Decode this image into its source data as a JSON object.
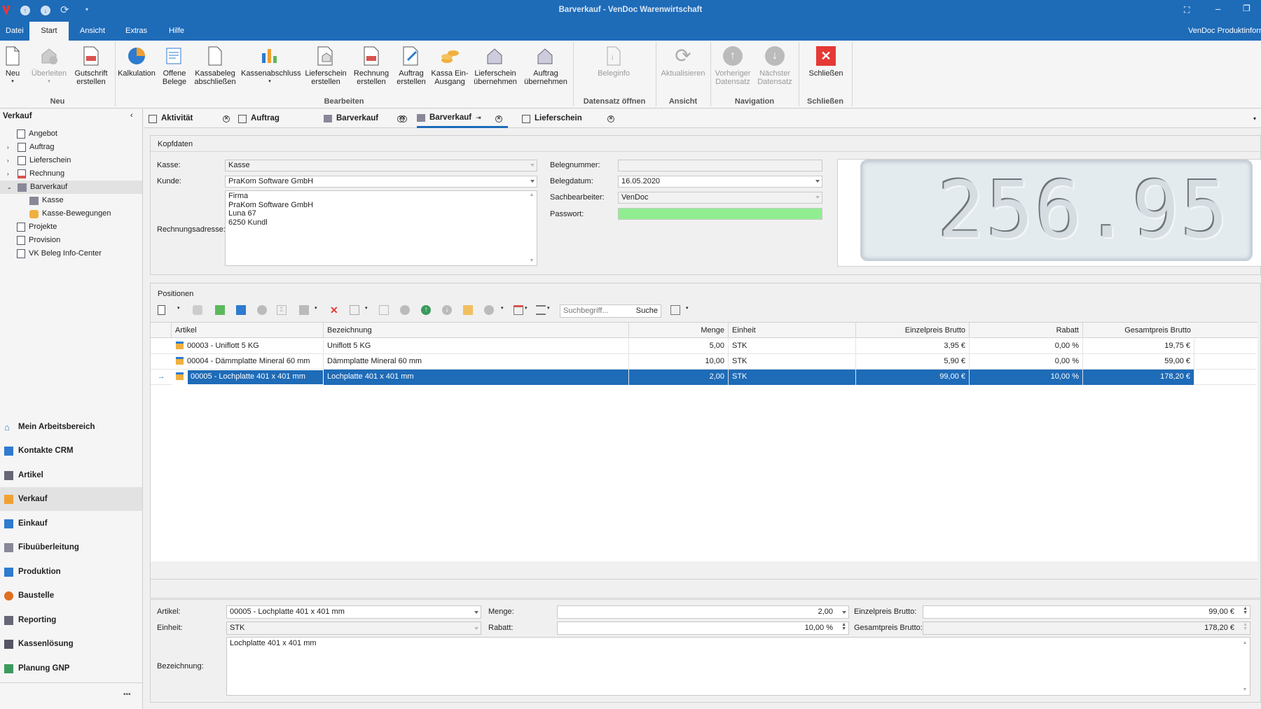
{
  "window": {
    "title": "Barverkauf - VenDoc Warenwirtschaft"
  },
  "menu": {
    "items": [
      "Datei",
      "Start",
      "Ansicht",
      "Extras",
      "Hilfe"
    ],
    "right_label": "VenDoc Produktinform"
  },
  "ribbon": {
    "buttons": [
      {
        "label": "Neu",
        "icon": "new-doc-icon"
      },
      {
        "label": "Überleiten",
        "icon": "transfer-icon"
      },
      {
        "label": "Gutschrift erstellen",
        "icon": "credit-note-icon"
      },
      {
        "label": "Kalkulation",
        "icon": "pie-chart-icon"
      },
      {
        "label": "Offene Belege",
        "icon": "open-docs-icon"
      },
      {
        "label": "Kassabeleg abschließen",
        "icon": "close-receipt-icon"
      },
      {
        "label": "Kassenabschluss",
        "icon": "cash-closing-icon"
      },
      {
        "label": "Lieferschein erstellen",
        "icon": "delivery-note-icon"
      },
      {
        "label": "Rechnung erstellen",
        "icon": "invoice-icon"
      },
      {
        "label": "Auftrag erstellen",
        "icon": "order-icon"
      },
      {
        "label": "Kassa Ein-Ausgang",
        "icon": "coins-icon"
      },
      {
        "label": "Lieferschein übernehmen",
        "icon": "take-delivery-icon"
      },
      {
        "label": "Auftrag übernehmen",
        "icon": "take-order-icon"
      },
      {
        "label": "Beleginfo",
        "icon": "info-doc-icon"
      },
      {
        "label": "Aktualisieren",
        "icon": "refresh-icon"
      },
      {
        "label": "Vorheriger Datensatz",
        "icon": "arrow-up-icon"
      },
      {
        "label": "Nächster Datensatz",
        "icon": "arrow-down-icon"
      },
      {
        "label": "Schließen",
        "icon": "close-red-icon"
      }
    ],
    "groups": [
      "Neu",
      "Bearbeiten",
      "Datensatz öffnen",
      "Ansicht",
      "Navigation",
      "Schließen"
    ]
  },
  "sidebar": {
    "header": "Verkauf",
    "tree": [
      "Angebot",
      "Auftrag",
      "Lieferschein",
      "Rechnung",
      "Barverkauf",
      "Kasse",
      "Kasse-Bewegungen",
      "Projekte",
      "Provision",
      "VK Beleg Info-Center"
    ],
    "nav": [
      "Mein Arbeitsbereich",
      "Kontakte CRM",
      "Artikel",
      "Verkauf",
      "Einkauf",
      "Fibuüberleitung",
      "Produktion",
      "Baustelle",
      "Reporting",
      "Kassenlösung",
      "Planung GNP"
    ],
    "more": "•••"
  },
  "tabs": [
    "Aktivität",
    "Auftrag",
    "Barverkauf",
    "Barverkauf",
    "Lieferschein"
  ],
  "kopfdaten": {
    "title": "Kopfdaten",
    "kasse_label": "Kasse:",
    "kasse_value": "Kasse",
    "kunde_label": "Kunde:",
    "kunde_value": "PraKom Software GmbH",
    "adresse_label": "Rechnungsadresse:",
    "adresse_lines": [
      "Firma",
      "PraKom Software GmbH",
      "Luna 67",
      "6250 Kundl"
    ],
    "belegnummer_label": "Belegnummer:",
    "belegnummer_value": "",
    "belegdatum_label": "Belegdatum:",
    "belegdatum_value": "16.05.2020",
    "sachbearbeiter_label": "Sachbearbeiter:",
    "sachbearbeiter_value": "VenDoc",
    "passwort_label": "Passwort:",
    "display_total": "256.95"
  },
  "positionen": {
    "title": "Positionen",
    "search_placeholder": "Suchbegriff...",
    "search_button": "Suche",
    "columns": [
      "Artikel",
      "Bezeichnung",
      "Menge",
      "Einheit",
      "Einzelpreis Brutto",
      "Rabatt",
      "Gesamtpreis Brutto"
    ],
    "rows": [
      [
        "00003 - Uniflott 5 KG",
        "Uniflott 5 KG",
        "5,00",
        "STK",
        "3,95 €",
        "0,00 %",
        "19,75 €"
      ],
      [
        "00004 - Dämmplatte Mineral 60 mm",
        "Dämmplatte Mineral 60 mm",
        "10,00",
        "STK",
        "5,90 €",
        "0,00 %",
        "59,00 €"
      ],
      [
        "00005 - Lochplatte 401 x 401 mm",
        "Lochplatte 401 x 401 mm",
        "2,00",
        "STK",
        "99,00 €",
        "10,00 %",
        "178,20 €"
      ]
    ]
  },
  "detail": {
    "artikel_label": "Artikel:",
    "artikel_value": "00005 - Lochplatte 401 x 401 mm",
    "einheit_label": "Einheit:",
    "einheit_value": "STK",
    "menge_label": "Menge:",
    "menge_value": "2,00",
    "rabatt_label": "Rabatt:",
    "rabatt_value": "10,00 %",
    "einzelpreis_label": "Einzelpreis Brutto:",
    "einzelpreis_value": "99,00 €",
    "gesamtpreis_label": "Gesamtpreis Brutto:",
    "gesamtpreis_value": "178,20 €",
    "bezeichnung_label": "Bezeichnung:",
    "bezeichnung_value": "Lochplatte 401 x 401 mm"
  },
  "colors": {
    "accent": "#1e6bb8",
    "password_field": "#90ee90",
    "close_red": "#e53935"
  }
}
